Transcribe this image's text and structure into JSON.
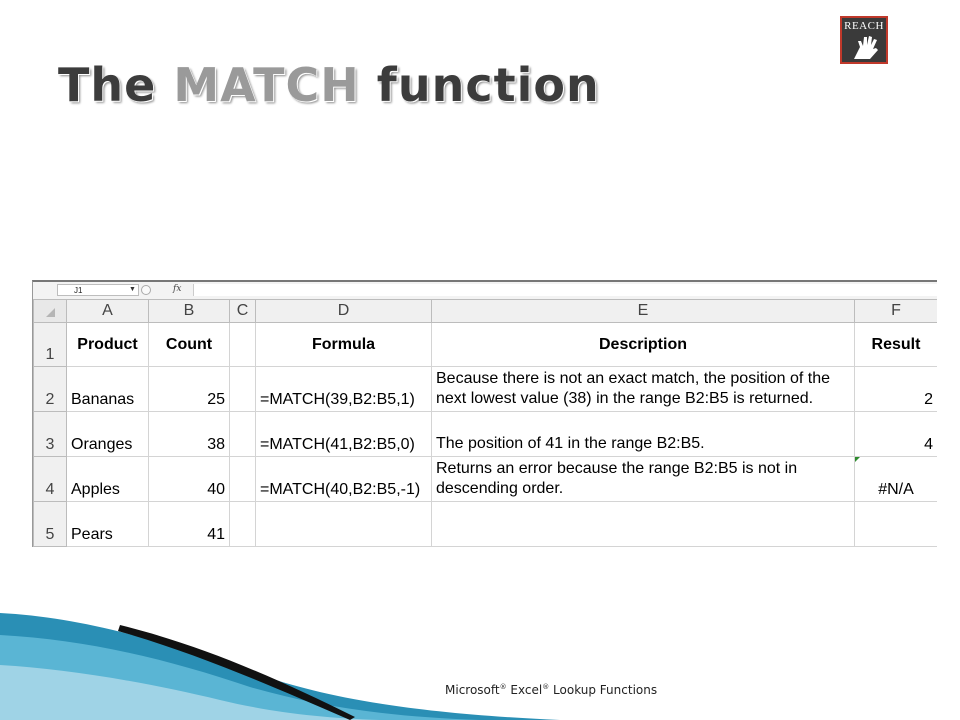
{
  "slide": {
    "title_part1": "The ",
    "title_part2": "MATCH",
    "title_part3": " function",
    "logo_text": "REACH",
    "footer": {
      "part1": "Microsoft",
      "part2": " Excel",
      "part3": " Lookup Functions",
      "sup": "®"
    }
  },
  "excel": {
    "name_box": "J1",
    "fx_label": "fx",
    "formula_value": "",
    "column_headers": [
      "A",
      "B",
      "C",
      "D",
      "E",
      "F"
    ],
    "rows": [
      {
        "num": "1",
        "product": "Product",
        "count": "Count",
        "c": "",
        "formula": "Formula",
        "description": "Description",
        "result": "Result"
      },
      {
        "num": "2",
        "product": "Bananas",
        "count": "25",
        "c": "",
        "formula": "=MATCH(39,B2:B5,1)",
        "description": "Because there is not an exact match, the position of the next lowest value (38) in the range B2:B5 is returned.",
        "result": "2"
      },
      {
        "num": "3",
        "product": "Oranges",
        "count": "38",
        "c": "",
        "formula": "=MATCH(41,B2:B5,0)",
        "description": "The position of 41 in the range B2:B5.",
        "result": "4"
      },
      {
        "num": "4",
        "product": "Apples",
        "count": "40",
        "c": "",
        "formula": "=MATCH(40,B2:B5,-1)",
        "description": "Returns an error because the range B2:B5 is not in descending order.",
        "result": "#N/A"
      },
      {
        "num": "5",
        "product": "Pears",
        "count": "41",
        "c": "",
        "formula": "",
        "description": "",
        "result": ""
      }
    ]
  },
  "colors": {
    "title_dark": "#3c3c3c",
    "title_light": "#9a9a9a",
    "header_bg": "#f0f0f0",
    "gridline": "#d4d4d4",
    "accent_teal": "#2a8fb5",
    "logo_border": "#c0392b"
  }
}
